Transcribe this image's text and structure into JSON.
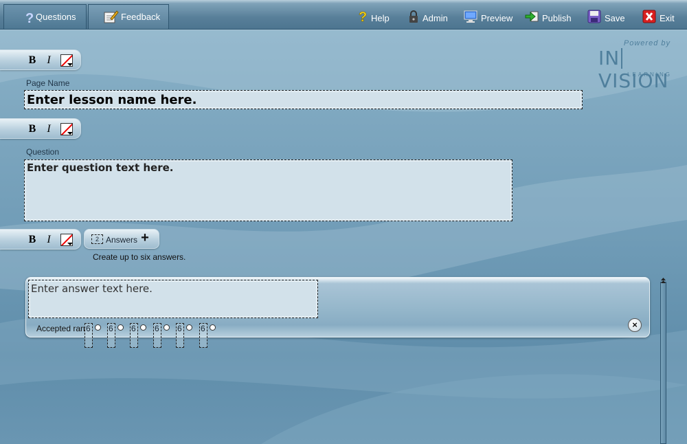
{
  "toolbar": {
    "tabs": [
      {
        "label": "Questions",
        "icon": "question-icon"
      },
      {
        "label": "Feedback",
        "icon": "feedback-icon"
      }
    ],
    "buttons": [
      {
        "label": "Help",
        "icon": "help-icon"
      },
      {
        "label": "Admin",
        "icon": "lock-icon"
      },
      {
        "label": "Preview",
        "icon": "monitor-icon"
      },
      {
        "label": "Publish",
        "icon": "publish-icon"
      },
      {
        "label": "Save",
        "icon": "save-icon"
      },
      {
        "label": "Exit",
        "icon": "exit-icon"
      }
    ]
  },
  "logo": {
    "powered_by": "Powered by",
    "brand_left": "IN",
    "brand_right": "VISION",
    "sub": "LEARNING"
  },
  "format_bar": {
    "bold": "B",
    "italic": "I"
  },
  "page_name": {
    "label": "Page Name",
    "value": "Enter lesson name here."
  },
  "question": {
    "label": "Question",
    "value": "Enter question text here."
  },
  "answers": {
    "count": "2",
    "label": "Answers",
    "hint": "Create up to six answers."
  },
  "answer_item": {
    "value": "Enter answer text here.",
    "accepted_rank_label": "Accepted ran",
    "ranks": [
      "6",
      "6",
      "6",
      "6",
      "6",
      "6"
    ]
  },
  "colors": {
    "accent": "#4d7590",
    "panel": "#d2e1ea",
    "logo": "#4f7f9c"
  }
}
